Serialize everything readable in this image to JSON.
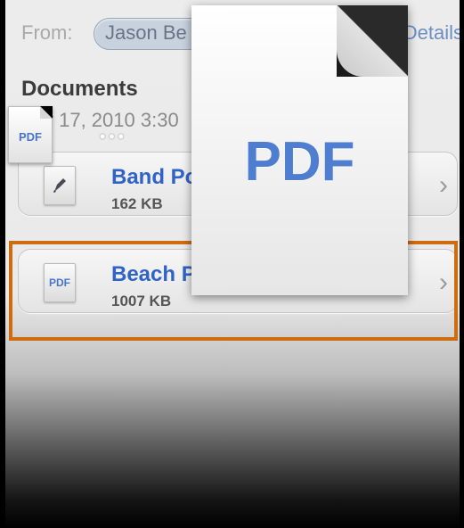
{
  "header": {
    "from_label": "From:",
    "from_name": "Jason Be",
    "details_label": "Details"
  },
  "documents": {
    "title": "Documents",
    "date": "y 17, 2010 3:30"
  },
  "attachments": [
    {
      "title": "Band Po",
      "size": "162 KB",
      "icon": "edit-document-icon",
      "selected": false
    },
    {
      "title": "Beach P",
      "size": "1007 KB",
      "icon": "pdf-file-icon",
      "icon_text": "PDF",
      "selected": true
    }
  ],
  "drag": {
    "small_label": "PDF",
    "big_label": "PDF",
    "dots": "•••"
  },
  "colors": {
    "accent": "#2f63c8",
    "selection": "#d06c10",
    "pdf_blue": "#4f7ed0"
  }
}
